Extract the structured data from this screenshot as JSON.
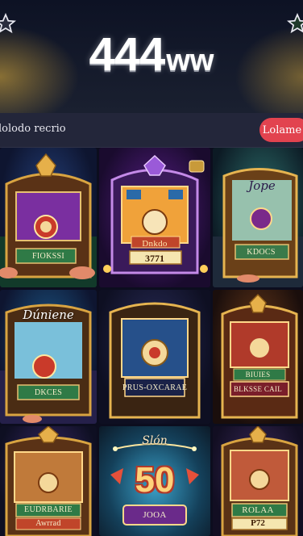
{
  "app": {
    "logo_number": "444",
    "logo_suffix": "ww"
  },
  "header": {
    "left_icon": "star-icon",
    "right_icon": "star-icon"
  },
  "bar": {
    "label": "lolodo recrio",
    "button_label": "Lolame"
  },
  "tiles": [
    {
      "label": "FIOKSSI"
    },
    {
      "label": "Dnkdo",
      "number": "3771"
    },
    {
      "name": "Jope",
      "label": "KDOCS"
    },
    {
      "name": "Dúniene",
      "label": "DKCES"
    },
    {
      "label": "PRUS-OXCARAE"
    },
    {
      "label": "BIUIES",
      "label2": "BLKSSE CAIL"
    },
    {
      "label": "EUDRBARIE",
      "label2": "Awrrad"
    },
    {
      "name": "Slón",
      "big_number": "50",
      "label": "JOOA"
    },
    {
      "label": "ROLAA",
      "number": "P72"
    }
  ],
  "colors": {
    "accent": "#e2434f",
    "gold": "#d9a441",
    "bar_bg": "#23263a"
  }
}
